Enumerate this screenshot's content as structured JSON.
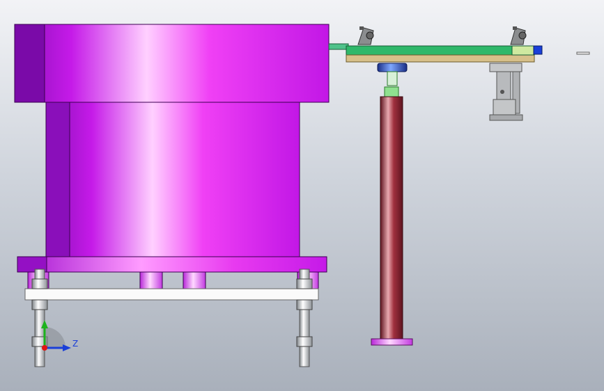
{
  "viewport": {
    "background_top": "#f2f3f6",
    "background_bottom": "#a9b0bb"
  },
  "colors": {
    "bowl_purple": "#e21cf0",
    "bowl_purple_dark": "#7a0aa8",
    "column_red": "#a0303e",
    "track_green": "#2fb86a",
    "plate_tan": "#d7c08a",
    "steel_gray": "#bfc3c8",
    "axis_y": "#1db31d",
    "axis_z": "#1a3fd8",
    "axis_x": "#e01414"
  },
  "triad": {
    "z_label": "Z"
  }
}
